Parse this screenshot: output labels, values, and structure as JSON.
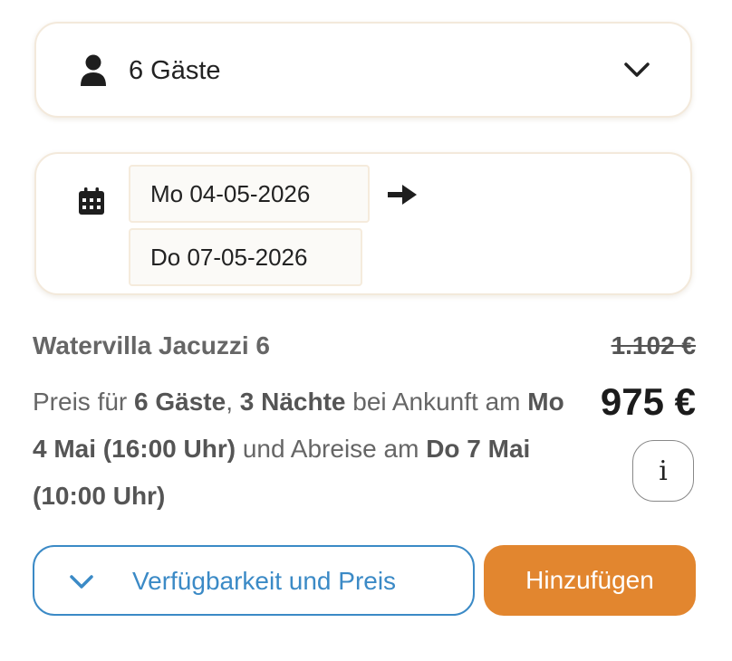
{
  "guests": {
    "label": "6 Gäste",
    "icon": "person-icon",
    "dropdown_icon": "chevron-down-icon"
  },
  "dates": {
    "icon": "calendar-icon",
    "arrival": "Mo 04-05-2026",
    "departure": "Do 07-05-2026",
    "arrow_icon": "arrow-right-icon"
  },
  "listing": {
    "title": "Watervilla Jacuzzi 6",
    "desc": {
      "p1": "Preis für ",
      "guests": "6 Gäste",
      "p2": ", ",
      "nights": "3 Nächte",
      "p3": " bei Ankunft am ",
      "arrival": "Mo 4 Mai (16:00 Uhr)",
      "p4": " und Abreise am ",
      "departure": "Do 7 Mai (10:00 Uhr)"
    },
    "old_price": "1.102 €",
    "price": "975 €",
    "info_label": "i"
  },
  "actions": {
    "availability_label": "Verfügbarkeit und Preis",
    "add_label": "Hinzufügen"
  },
  "colors": {
    "accent_blue": "#3b8ac6",
    "accent_orange": "#e2862f",
    "card_border": "#f3e9db"
  }
}
